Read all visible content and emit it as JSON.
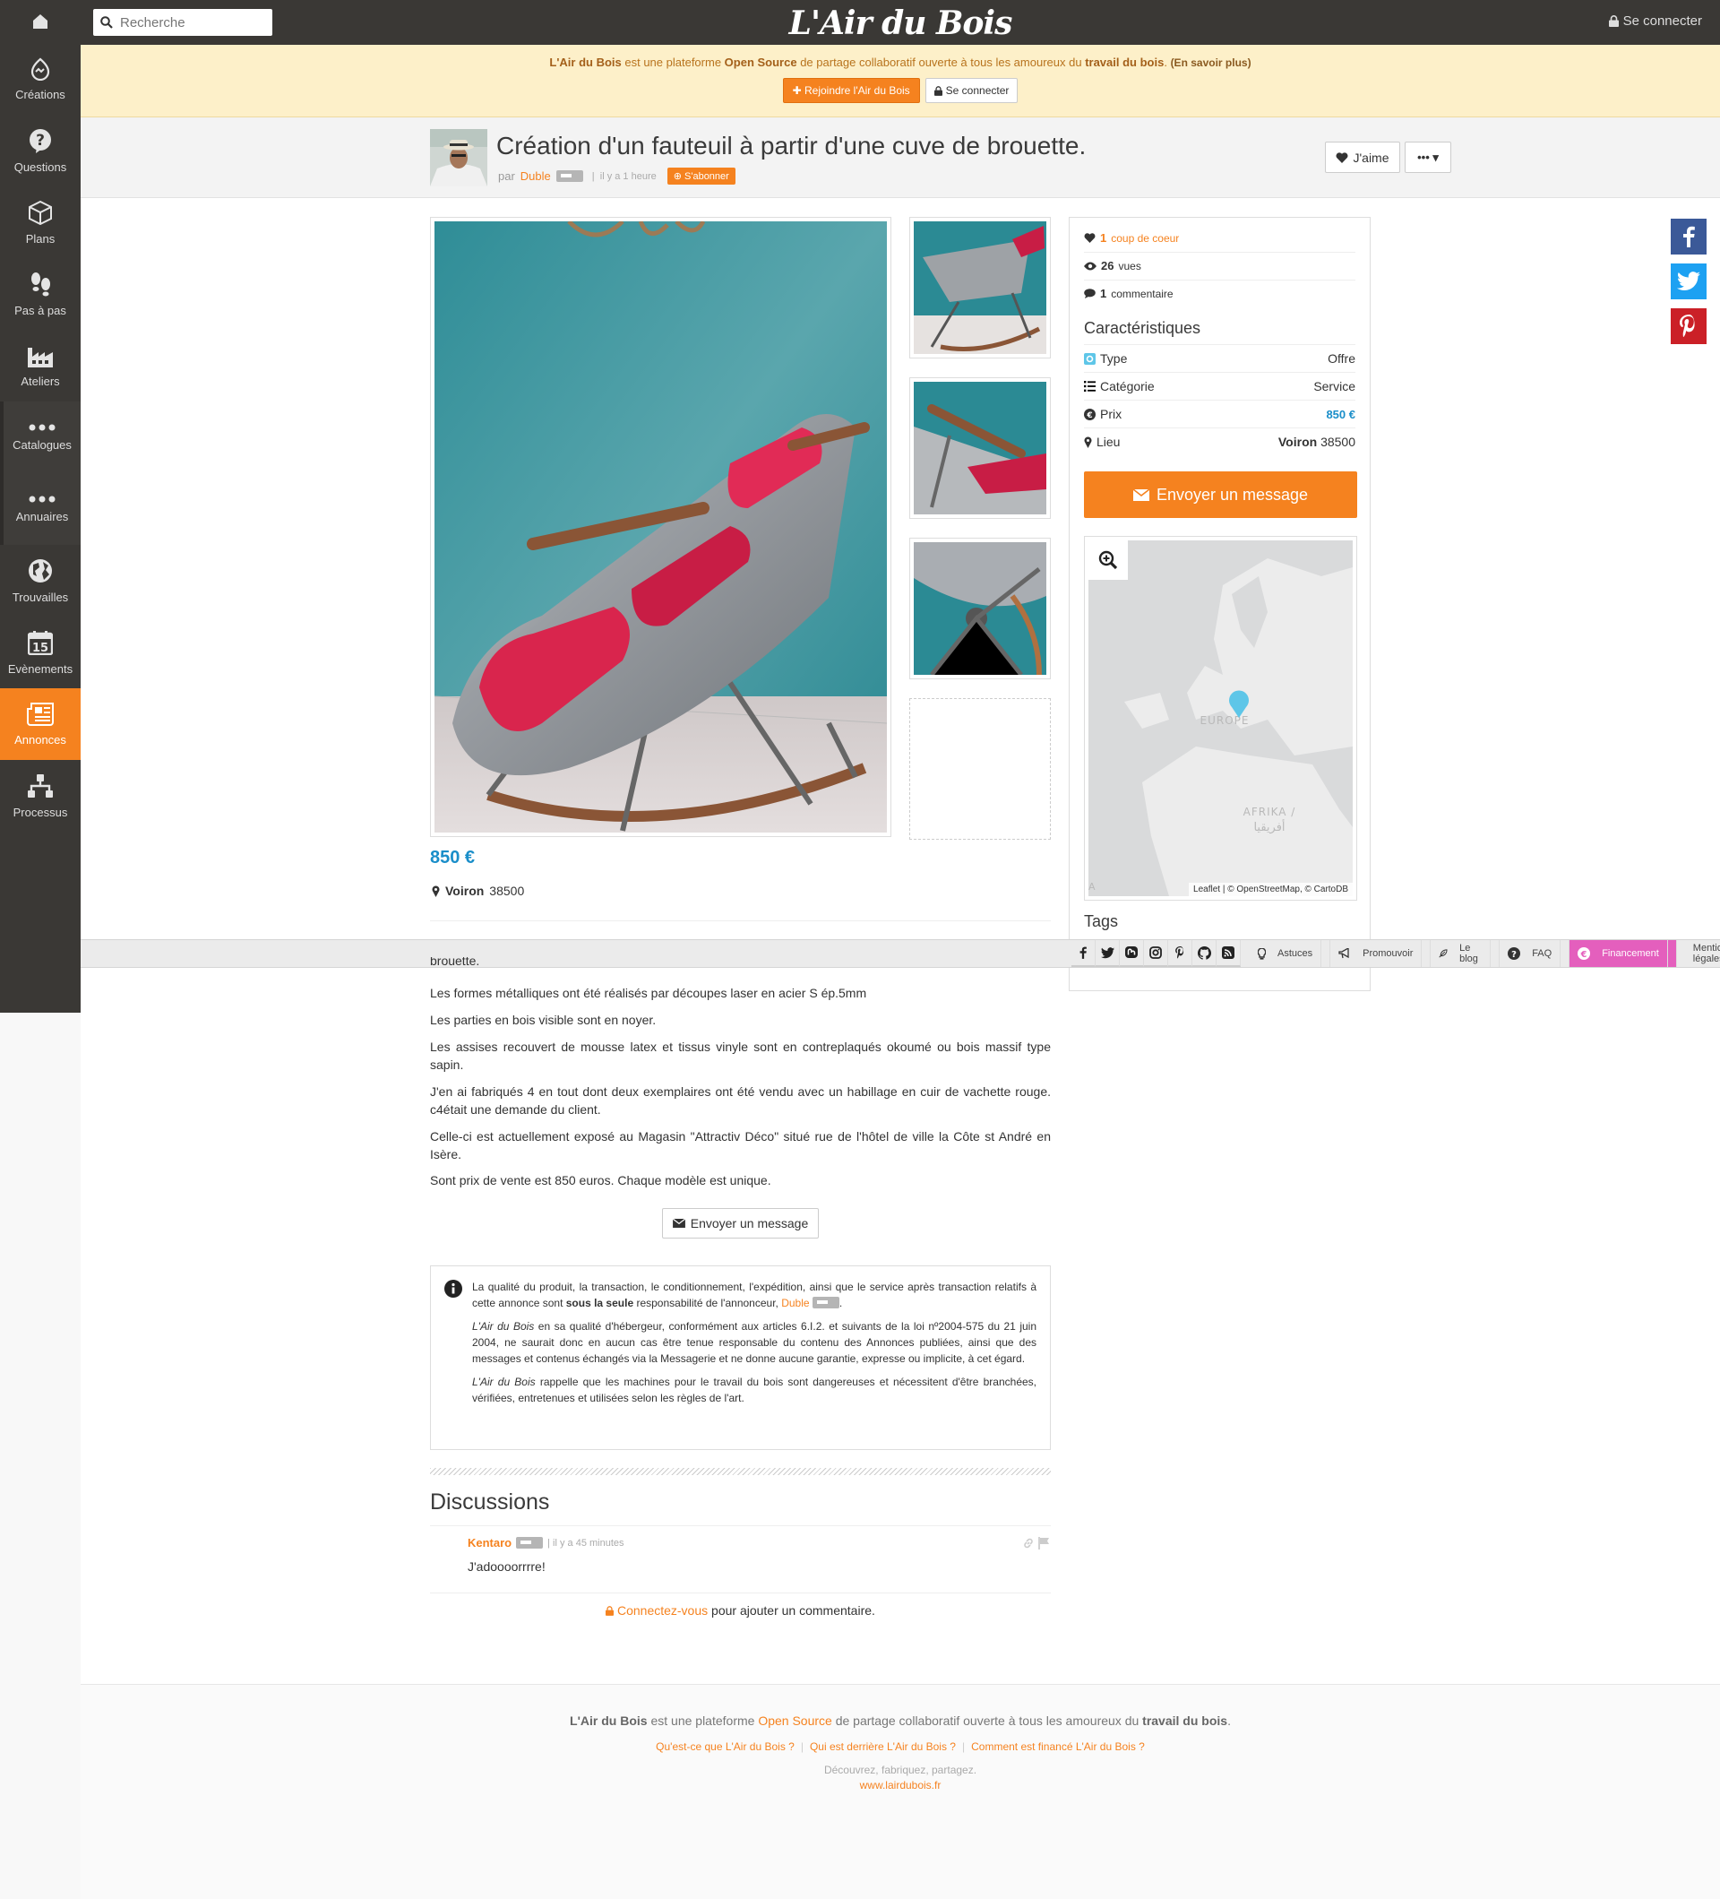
{
  "header": {
    "logo": "L'Air du Bois",
    "search_placeholder": "Recherche",
    "login": "Se connecter"
  },
  "sidebar": {
    "items": [
      {
        "label": "Créations",
        "icon": "creations-icon"
      },
      {
        "label": "Questions",
        "icon": "question-icon"
      },
      {
        "label": "Plans",
        "icon": "cube-icon"
      },
      {
        "label": "Pas à pas",
        "icon": "footsteps-icon"
      },
      {
        "label": "Ateliers",
        "icon": "factory-icon"
      },
      {
        "label": "Catalogues",
        "icon": "dots-icon"
      },
      {
        "label": "Annuaires",
        "icon": "dots-icon"
      },
      {
        "label": "Trouvailles",
        "icon": "globe-icon"
      },
      {
        "label": "Evènements",
        "icon": "calendar-icon",
        "day": "15"
      },
      {
        "label": "Annonces",
        "icon": "newspaper-icon"
      },
      {
        "label": "Processus",
        "icon": "process-icon"
      }
    ]
  },
  "banner": {
    "brand": "L'Air du Bois",
    "t1": " est une plateforme ",
    "open_source": "Open Source",
    "t2": " de partage collaboratif ouverte à tous les amoureux du ",
    "wood": "travail du bois",
    "t3": ". ",
    "more": "(En savoir plus)",
    "join": "Rejoindre l'Air du Bois",
    "login": "Se connecter"
  },
  "post": {
    "title": "Création d'un fauteuil à partir d'une cuve de brouette.",
    "by": "par",
    "author": "Duble",
    "time": "il y a 1 heure",
    "subscribe": "S'abonner",
    "like": "J'aime",
    "more": "•••"
  },
  "stats": {
    "likes_count": "1",
    "likes_label": "coup de coeur",
    "views_count": "26",
    "views_label": "vues",
    "comments_count": "1",
    "comments_label": "commentaire"
  },
  "characteristics": {
    "heading": "Caractéristiques",
    "rows": [
      {
        "label": "Type",
        "value": "Offre"
      },
      {
        "label": "Catégorie",
        "value": "Service"
      },
      {
        "label": "Prix",
        "value": "850 €"
      },
      {
        "label": "Lieu",
        "city": "Voiron",
        "zip": "38500"
      }
    ],
    "send": "Envoyer un message",
    "tags": "Tags"
  },
  "map": {
    "europe": "EUROPE",
    "africa": "AFRIKA /",
    "africa_ar": "أفريقيا",
    "attribution": "Leaflet | © OpenStreetMap, © CartoDB",
    "edge": "A"
  },
  "listing": {
    "price": "850 €",
    "city": "Voiron",
    "zip": "38500"
  },
  "article": {
    "cut": "brouette.",
    "p1": "Les formes métalliques ont été réalisés par découpes laser en acier S ép.5mm",
    "p2": "Les parties en bois visible sont en noyer.",
    "p3": "Les assises recouvert de mousse latex et tissus vinyle sont en contreplaqués okoumé ou bois massif type sapin.",
    "p4": "J'en ai fabriqués 4 en tout dont deux exemplaires ont été vendu avec un habillage en cuir de vachette rouge. c4était une demande du client.",
    "p5": "Celle-ci est actuellement exposé au Magasin \"Attractiv Déco\" situé rue de l'hôtel de ville la Côte st André en Isère.",
    "p6": "Sont prix de vente est 850 euros. Chaque modèle est unique.",
    "send": "Envoyer un message"
  },
  "disclaimer": {
    "a1": "La qualité du produit, la transaction, le conditionnement, l'expédition, ainsi que le service après transaction relatifs à cette annonce sont ",
    "a_bold": "sous la seule",
    "a2": " responsabilité de l'annonceur, ",
    "a_author": "Duble",
    "b_brand": "L'Air du Bois",
    "b_text": " en sa qualité d'hébergeur, conformément aux articles 6.I.2. et suivants de la loi nº2004-575 du 21 juin 2004, ne saurait donc en aucun cas être tenue responsable du contenu des Annonces publiées, ainsi que des messages et contenus échangés via la Messagerie et ne donne aucune garantie, expresse ou implicite, à cet égard.",
    "c_brand": "L'Air du Bois",
    "c_text": " rappelle que les machines pour le travail du bois sont dangereuses et nécessitent d'être branchées, vérifiées, entretenues et utilisées selon les règles de l'art."
  },
  "discussions": {
    "heading": "Discussions",
    "author": "Kentaro",
    "time": "il y a 45 minutes",
    "text": "J'adoooorrrre!",
    "connect_link": "Connectez-vous",
    "connect_rest": " pour ajouter un commentaire."
  },
  "toolbar": {
    "links": [
      "Astuces",
      "Promouvoir",
      "Le blog",
      "FAQ",
      "Financement",
      "Mentions légales"
    ]
  },
  "footer": {
    "brand": "L'Air du Bois",
    "t1": " est une plateforme ",
    "open_source": "Open Source",
    "t2": " de partage collaboratif ouverte à tous les amoureux du ",
    "wood": "travail du bois",
    "t3": ".",
    "links": [
      "Qu'est-ce que L'Air du Bois ?",
      "Qui est derrière L'Air du Bois ?",
      "Comment est financé L'Air du Bois ?"
    ],
    "tagline": "Découvrez, fabriquez, partagez.",
    "url": "www.lairdubois.fr"
  },
  "colors": {
    "accent": "#f5821f",
    "price": "#1a8ec9",
    "dark": "#3a3835",
    "financement": "#e45fbd"
  }
}
